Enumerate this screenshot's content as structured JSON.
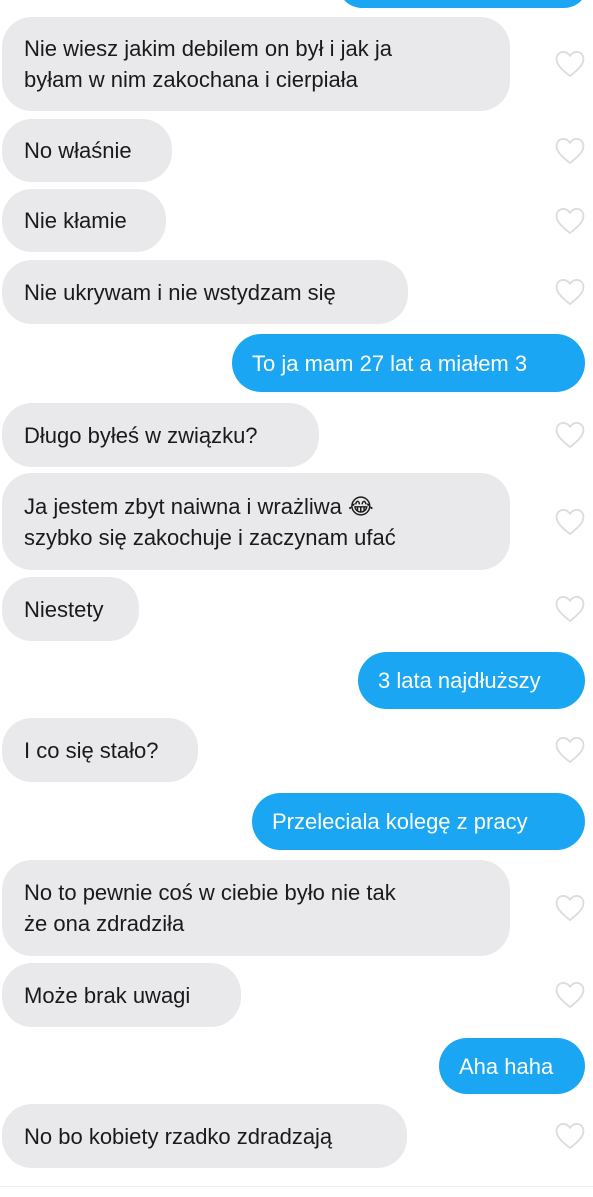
{
  "conversation": {
    "messages": [
      {
        "side": "received",
        "text": "Nie wiesz jakim debilem on był i jak ja\nbyłam w nim zakochana i cierpiała"
      },
      {
        "side": "received",
        "text": "No właśnie"
      },
      {
        "side": "received",
        "text": "Nie kłamie"
      },
      {
        "side": "received",
        "text": "Nie ukrywam i nie wstydzam się"
      },
      {
        "side": "sent",
        "text": "To ja mam 27 lat a miałem 3"
      },
      {
        "side": "received",
        "text": "Długo byłeś w związku?"
      },
      {
        "side": "received",
        "text": "Ja jestem zbyt naiwna i wrażliwa 😂\nszybko się zakochuje i zaczynam ufać"
      },
      {
        "side": "received",
        "text": "Niestety"
      },
      {
        "side": "sent",
        "text": "3 lata najdłuższy"
      },
      {
        "side": "received",
        "text": "I co się stało?"
      },
      {
        "side": "sent",
        "text": "Przeleciala kolegę z pracy"
      },
      {
        "side": "received",
        "text": "No to pewnie coś w ciebie było nie tak\nże ona zdradziła"
      },
      {
        "side": "received",
        "text": "Może brak uwagi"
      },
      {
        "side": "sent",
        "text": "Aha haha"
      },
      {
        "side": "received",
        "text": "No bo kobiety rzadko zdradzają"
      }
    ]
  },
  "colors": {
    "sent_bubble": "#1aa6f2",
    "received_bubble": "#e9e9eb",
    "heart_outline": "#dcdcdc"
  },
  "icons": {
    "like": "heart-outline-icon"
  }
}
